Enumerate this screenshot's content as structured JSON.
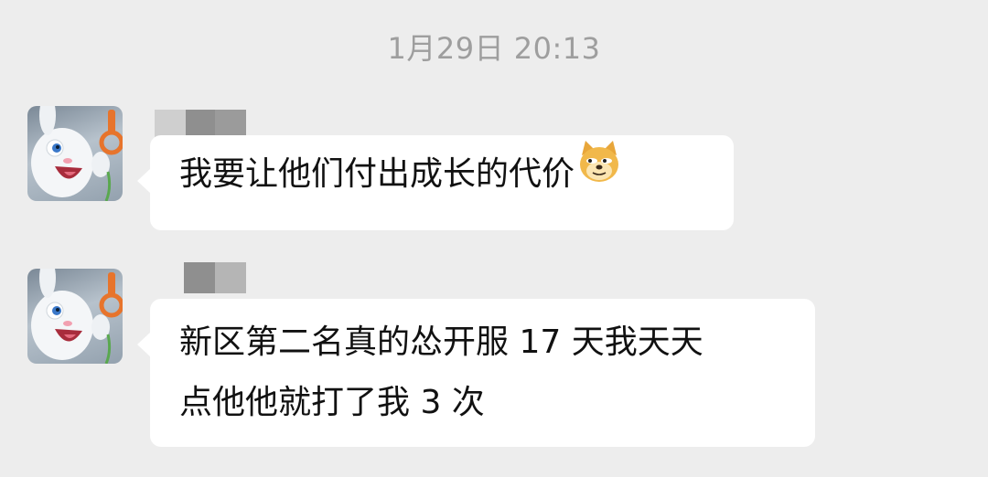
{
  "chat": {
    "timestamp": "1月29日 20:13",
    "messages": [
      {
        "avatar_icon": "snowball-bunny-avatar",
        "sender_name_redacted": true,
        "text": "我要让他们付出成长的代价",
        "trailing_emoji": "doge-emoji"
      },
      {
        "avatar_icon": "snowball-bunny-avatar",
        "sender_name_redacted": true,
        "text_line1": "新区第二名真的怂开服 17 天我天天",
        "text_line2": "点他他就打了我 3 次"
      }
    ]
  },
  "colors": {
    "background": "#ededed",
    "bubble": "#ffffff",
    "timestamp": "#9e9e9e",
    "text": "#111111"
  }
}
